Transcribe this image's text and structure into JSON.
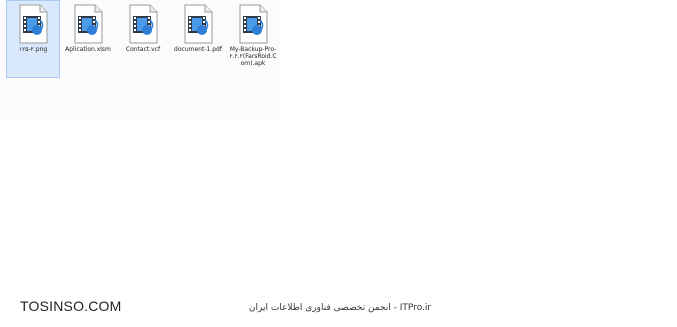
{
  "files": [
    {
      "name": "۱۲۵-۲.png",
      "selected": true,
      "icon": "media-file-icon"
    },
    {
      "name": "Aplication.xlsm",
      "selected": false,
      "icon": "media-file-icon"
    },
    {
      "name": "Contact.vcf",
      "selected": false,
      "icon": "media-file-icon"
    },
    {
      "name": "document-1.pdf",
      "selected": false,
      "icon": "media-file-icon"
    },
    {
      "name": "My-Backup-Pro-۲.۲.۲(FarsRoid.Com).apk",
      "selected": false,
      "icon": "media-file-icon"
    }
  ],
  "watermarks": {
    "left": "TOSINSO.COM",
    "center": "ITPro.ir - انجمن تخصصی فناوری اطلاعات ایران"
  },
  "colors": {
    "selection_bg": "#d9e8fb",
    "selection_border": "#a9cbf3",
    "film_blue": "#2f7fd8"
  }
}
